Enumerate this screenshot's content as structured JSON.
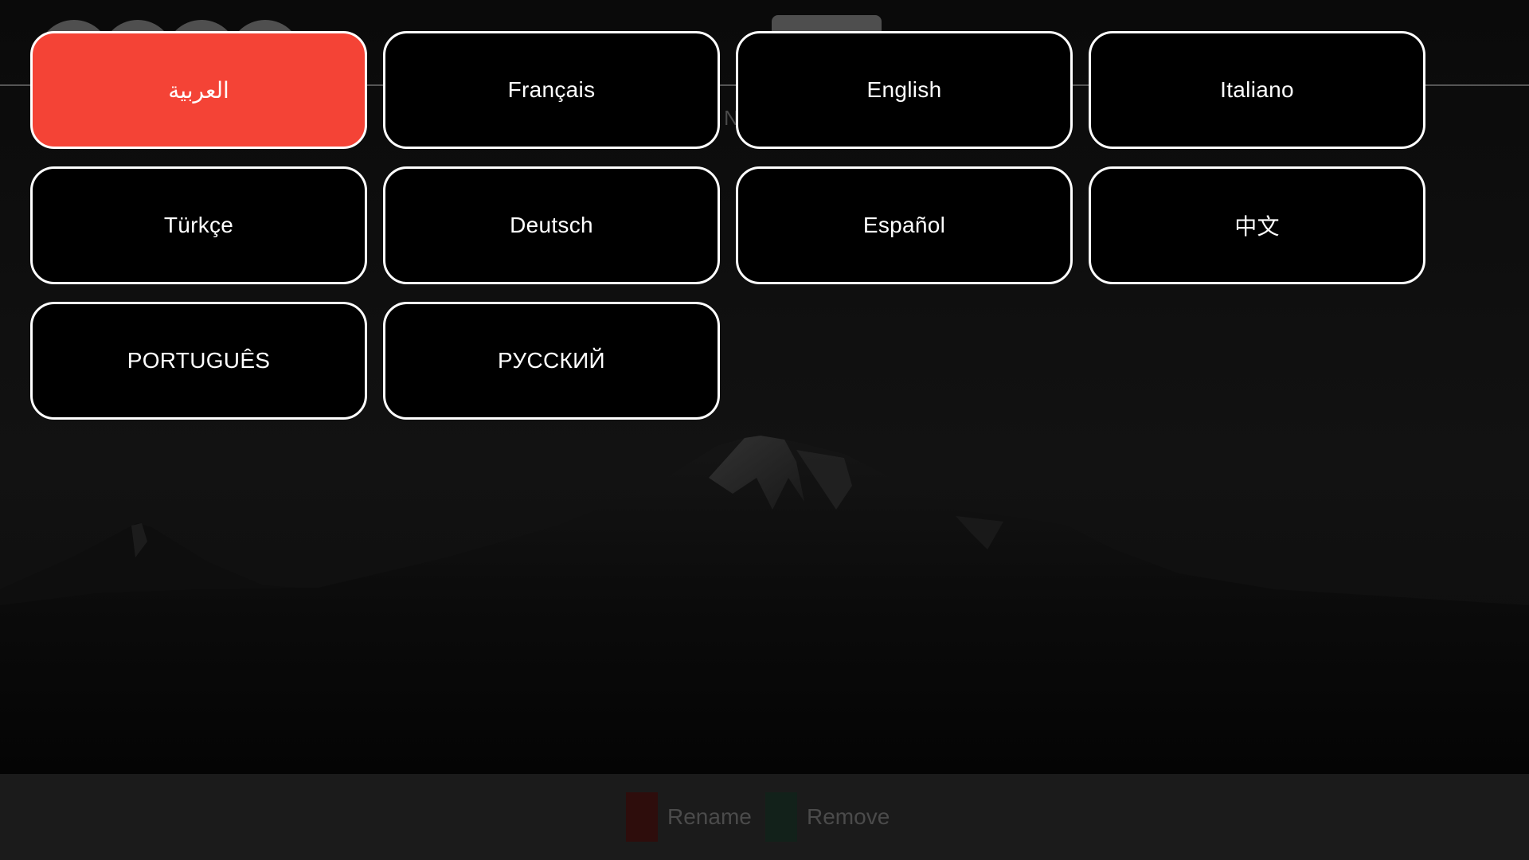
{
  "languages": [
    {
      "label": "العربية",
      "selected": true
    },
    {
      "label": "Français",
      "selected": false
    },
    {
      "label": "English",
      "selected": false
    },
    {
      "label": "Italiano",
      "selected": false
    },
    {
      "label": "Türkçe",
      "selected": false
    },
    {
      "label": "Deutsch",
      "selected": false
    },
    {
      "label": "Español",
      "selected": false
    },
    {
      "label": "中文",
      "selected": false
    },
    {
      "label": "PORTUGUÊS",
      "selected": false
    },
    {
      "label": "РУССКИЙ",
      "selected": false
    }
  ],
  "header": {
    "partial_letter": "N"
  },
  "bottom_bar": {
    "rename_label": "Rename",
    "remove_label": "Remove",
    "rename_color": "#2e0d0c",
    "remove_color": "#12211a"
  },
  "colors": {
    "selected_accent": "#f44336",
    "button_border": "#ffffff",
    "button_bg": "#000000"
  }
}
